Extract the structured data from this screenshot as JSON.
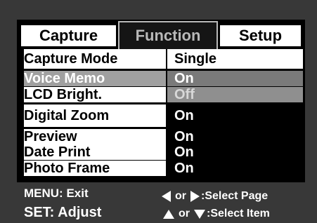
{
  "tabs": [
    {
      "label": "Capture"
    },
    {
      "label": "Function"
    },
    {
      "label": "Setup"
    }
  ],
  "menu": {
    "rows": [
      {
        "label": "Capture Mode",
        "value": "Single"
      },
      {
        "label": "Voice Memo",
        "value": "On"
      },
      {
        "label": "LCD Bright.",
        "value": "Off"
      },
      {
        "label": "Digital Zoom",
        "value": "On"
      },
      {
        "label": "Preview",
        "value": "On"
      },
      {
        "label": "Date Print",
        "value": "On"
      },
      {
        "label": "Photo Frame",
        "value": "On"
      }
    ]
  },
  "footer": {
    "menu_hint": "MENU: Exit",
    "set_hint": "SET: Adjust",
    "or_word": "or",
    "select_page": ":Select Page",
    "select_item": ":Select Item"
  },
  "colors": {
    "background": "#383838",
    "active_tab_text": "#b9b9b9",
    "highlight_row": "#a0a0a0"
  }
}
